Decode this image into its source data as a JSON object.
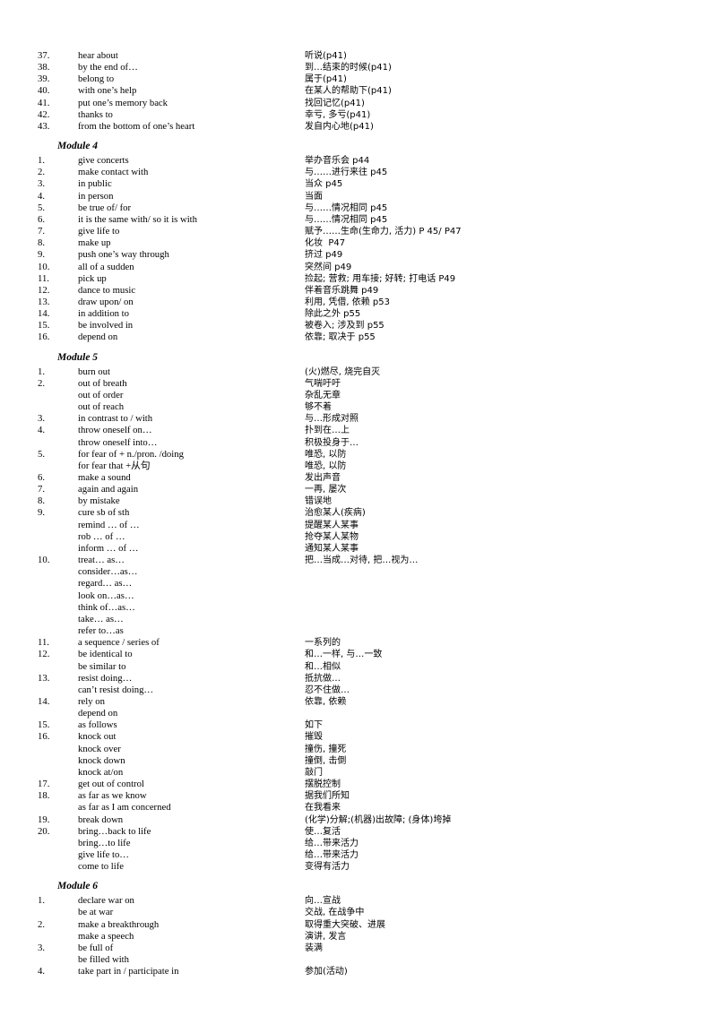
{
  "document": {
    "sections": [
      {
        "heading": "",
        "rows": [
          {
            "num": "37.",
            "en": "hear about",
            "cn": "听说(p41)"
          },
          {
            "num": "38.",
            "en": "by the end of…",
            "cn": "到…结束的时候(p41)"
          },
          {
            "num": "39.",
            "en": "belong to",
            "cn": "属于(p41)"
          },
          {
            "num": "40.",
            "en": "with one’s help",
            "cn": "在某人的帮助下(p41)"
          },
          {
            "num": "41.",
            "en": "put one’s memory back",
            "cn": "找回记忆(p41)"
          },
          {
            "num": "42.",
            "en": "thanks to",
            "cn": "幸亏, 多亏(p41)"
          },
          {
            "num": "43.",
            "en": "from the bottom of one’s heart",
            "cn": "发自内心地(p41)"
          }
        ]
      },
      {
        "heading": "Module 4",
        "rows": [
          {
            "num": "1.",
            "en": "give concerts",
            "cn": "举办音乐会 p44"
          },
          {
            "num": "2.",
            "en": "make contact with",
            "cn": "与……进行来往 p45"
          },
          {
            "num": "3.",
            "en": "in public",
            "cn": "当众 p45"
          },
          {
            "num": "4.",
            "en": "in person",
            "cn": "当面"
          },
          {
            "num": "5.",
            "en": "be true of/ for",
            "cn": "与……情况相同 p45"
          },
          {
            "num": "6.",
            "en": "it is the same with/ so it is with",
            "cn": "与……情况相同 p45"
          },
          {
            "num": "7.",
            "en": "give life to",
            "cn": "赋予……生命(生命力, 活力) P 45/ P47"
          },
          {
            "num": "8.",
            "en": "make up",
            "cn": "化妆  P47"
          },
          {
            "num": "9.",
            "en": "push one’s way through",
            "cn": "挤过 p49"
          },
          {
            "num": "10.",
            "en": "all of a sudden",
            "cn": "突然间 p49"
          },
          {
            "num": "11.",
            "en": "pick up",
            "cn": "捡起; 营救; 用车接; 好转; 打电话 P49"
          },
          {
            "num": "12.",
            "en": "dance to music",
            "cn": "伴着音乐跳舞 p49"
          },
          {
            "num": "13.",
            "en": "draw upon/ on",
            "cn": "利用, 凭借, 依赖 p53"
          },
          {
            "num": "14.",
            "en": "in addition to",
            "cn": "除此之外 p55"
          },
          {
            "num": "15.",
            "en": "be involved in",
            "cn": "被卷入; 涉及到 p55"
          },
          {
            "num": "16.",
            "en": "depend on",
            "cn": "依靠; 取决于 p55"
          }
        ]
      },
      {
        "heading": "Module 5",
        "rows": [
          {
            "num": "1.",
            "en": "burn out",
            "cn": "(火)燃尽, 烧完自灭"
          },
          {
            "num": "2.",
            "en": "out of breath",
            "cn": "气喘吁吁"
          },
          {
            "num": "",
            "en": "out of order",
            "cn": "杂乱无章"
          },
          {
            "num": "",
            "en": "out of reach",
            "cn": "够不着"
          },
          {
            "num": "3.",
            "en": "in contrast to / with",
            "cn": "与…形成对照"
          },
          {
            "num": "4.",
            "en": "throw oneself on…",
            "cn": "扑到在…上"
          },
          {
            "num": "",
            "en": "throw oneself into…",
            "cn": "积极投身于…"
          },
          {
            "num": "5.",
            "en": "for fear of + n./pron. /doing",
            "cn": "唯恐, 以防"
          },
          {
            "num": "",
            "en": "for fear that +从句",
            "cn": "唯恐, 以防"
          },
          {
            "num": "6.",
            "en": "make a sound",
            "cn": "发出声音"
          },
          {
            "num": "7.",
            "en": "again and again",
            "cn": "一再, 屡次"
          },
          {
            "num": "8.",
            "en": "by mistake",
            "cn": "错误地"
          },
          {
            "num": "9.",
            "en": "cure sb of sth",
            "cn": "治愈某人(疾病)"
          },
          {
            "num": "",
            "en": "remind … of …",
            "cn": "提醒某人某事"
          },
          {
            "num": "",
            "en": "rob … of …",
            "cn": "抢夺某人某物"
          },
          {
            "num": "",
            "en": "inform … of …",
            "cn": "通知某人某事"
          },
          {
            "num": "10.",
            "en": "treat… as…",
            "cn": "把…当成…对待, 把…视为…"
          },
          {
            "num": "",
            "en": "consider…as…",
            "cn": ""
          },
          {
            "num": "",
            "en": "regard… as…",
            "cn": ""
          },
          {
            "num": "",
            "en": "look on…as…",
            "cn": ""
          },
          {
            "num": "",
            "en": "think of…as…",
            "cn": ""
          },
          {
            "num": "",
            "en": "take… as…",
            "cn": ""
          },
          {
            "num": "",
            "en": "refer to…as",
            "cn": ""
          },
          {
            "num": "11.",
            "en": "a sequence / series of",
            "cn": "一系列的"
          },
          {
            "num": "12.",
            "en": "be identical to",
            "cn": "和…一样, 与…一致"
          },
          {
            "num": "",
            "en": "be similar to",
            "cn": "和…相似"
          },
          {
            "num": "13.",
            "en": "resist doing…",
            "cn": "抵抗做…"
          },
          {
            "num": "",
            "en": "can’t resist doing…",
            "cn": "忍不住做…"
          },
          {
            "num": "14.",
            "en": "rely on",
            "cn": "依靠, 依赖"
          },
          {
            "num": "",
            "en": "depend on",
            "cn": ""
          },
          {
            "num": "15.",
            "en": "as follows",
            "cn": "如下"
          },
          {
            "num": "16.",
            "en": "knock out",
            "cn": "摧毁"
          },
          {
            "num": "",
            "en": "knock over",
            "cn": "撞伤, 撞死"
          },
          {
            "num": "",
            "en": "knock down",
            "cn": "撞倒, 击倒"
          },
          {
            "num": "",
            "en": "knock at/on",
            "cn": "敲门"
          },
          {
            "num": "17.",
            "en": "get out of control",
            "cn": "摆脱控制"
          },
          {
            "num": "18.",
            "en": "as far as we know",
            "cn": "据我们所知"
          },
          {
            "num": "",
            "en": "as far as I am concerned",
            "cn": "在我看来"
          },
          {
            "num": "19.",
            "en": "break down",
            "cn": "(化学)分解;(机器)出故障; (身体)垮掉"
          },
          {
            "num": "20.",
            "en": "bring…back to life",
            "cn": "使…复活"
          },
          {
            "num": "",
            "en": "bring…to life",
            "cn": "给…带来活力"
          },
          {
            "num": "",
            "en": "give life to…",
            "cn": "给…带来活力"
          },
          {
            "num": "",
            "en": "come to life",
            "cn": "变得有活力"
          }
        ]
      },
      {
        "heading": "Module 6",
        "rows": [
          {
            "num": "1.",
            "en": "declare war on",
            "cn": "向…宣战"
          },
          {
            "num": "",
            "en": "be at war",
            "cn": "交战, 在战争中"
          },
          {
            "num": "2.",
            "en": "make a breakthrough",
            "cn": "取得重大突破、进展"
          },
          {
            "num": "",
            "en": "make a speech",
            "cn": "演讲, 发言"
          },
          {
            "num": "3.",
            "en": "be full of",
            "cn": "装满"
          },
          {
            "num": "",
            "en": "be filled with",
            "cn": ""
          },
          {
            "num": "4.",
            "en": "take part in / participate in",
            "cn": "参加(活动)"
          }
        ]
      }
    ]
  }
}
